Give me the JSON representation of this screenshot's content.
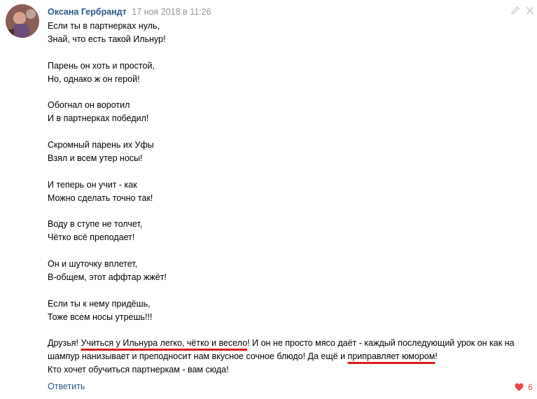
{
  "post": {
    "author": "Оксана Гербрандт",
    "date": "17 ноя 2018 в 11:26",
    "stanzas": [
      [
        "Если ты в партнерках нуль,",
        "Знай, что есть такой Ильнур!"
      ],
      [
        "Парень он хоть и простой,",
        "Но, однако ж он герой!"
      ],
      [
        "Обогнал он воротил",
        "И в партнерках победил!"
      ],
      [
        "Скромный парень их Уфы",
        "Взял и всем утер носы!"
      ],
      [
        "И теперь он учит - как",
        "Можно сделать точно так!"
      ],
      [
        "Воду в ступе не толчет,",
        "Чётко всё преподает!"
      ],
      [
        "Он и шуточку вплетет,",
        "В-общем, этот аффтар жжёт!"
      ],
      [
        "Если ты к нему придёшь,",
        "Тоже всем носы утрешь!!!"
      ]
    ],
    "final_paragraph": {
      "part1": "Друзья! ",
      "highlight1": "Учиться у Ильнура легко, чётко и весело",
      "part2": "! И он не просто мясо даёт - каждый последующий урок он как на шампур нанизывает и преподносит нам вкусное сочное блюдо! Да ещё и ",
      "highlight2": "приправляет юмором",
      "part3": "!"
    },
    "last_line": "Кто хочет обучиться партнеркам - вам сюда!",
    "reply_label": "Ответить",
    "likes_count": "6",
    "icons": {
      "avatar": "avatar-photo",
      "edit": "pencil-icon",
      "close": "close-icon",
      "like": "heart-icon"
    },
    "colors": {
      "link": "#2a5885",
      "date": "#939393",
      "highlight_underline": "#d91e18",
      "like": "#e64646"
    }
  }
}
